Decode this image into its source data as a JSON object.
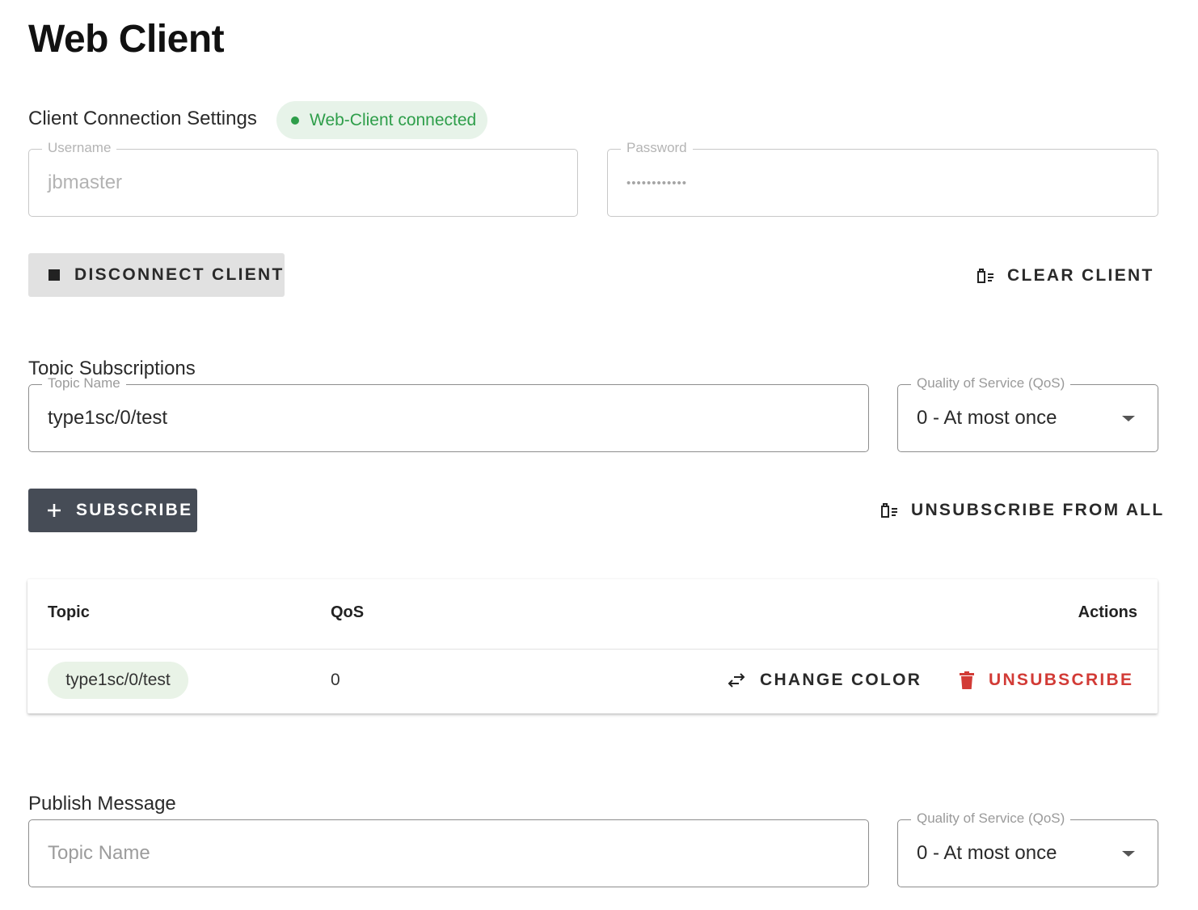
{
  "page": {
    "title": "Web Client"
  },
  "connection": {
    "section_title": "Client Connection Settings",
    "status": {
      "text": "Web-Client connected",
      "color": "#2e9e4a"
    },
    "username": {
      "label": "Username",
      "value": "jbmaster"
    },
    "password": {
      "label": "Password",
      "masked_value": "••••••••••••"
    },
    "disconnect_label": "DISCONNECT CLIENT",
    "clear_label": "CLEAR CLIENT"
  },
  "subscriptions": {
    "section_title": "Topic Subscriptions",
    "topic_field": {
      "label": "Topic Name",
      "value": "type1sc/0/test"
    },
    "qos_field": {
      "label": "Quality of Service (QoS)",
      "value": "0 - At most once"
    },
    "subscribe_label": "SUBSCRIBE",
    "unsubscribe_all_label": "UNSUBSCRIBE FROM ALL",
    "table": {
      "columns": [
        "Topic",
        "QoS",
        "Actions"
      ],
      "rows": [
        {
          "topic": "type1sc/0/test",
          "qos": "0",
          "change_color_label": "CHANGE COLOR",
          "unsubscribe_label": "UNSUBSCRIBE"
        }
      ]
    }
  },
  "publish": {
    "section_title": "Publish Message",
    "topic_field": {
      "placeholder": "Topic Name"
    },
    "qos_field": {
      "label": "Quality of Service (QoS)",
      "value": "0 - At most once"
    }
  },
  "icons": {
    "stop": "stop-icon",
    "clear": "clear-list-icon",
    "plus": "plus-icon",
    "swap": "swap-arrows-icon",
    "trash": "trash-icon",
    "dropdown": "chevron-down-icon"
  },
  "colors": {
    "accent_dark": "#464c56",
    "danger": "#d23b36",
    "success": "#2e9e4a"
  }
}
